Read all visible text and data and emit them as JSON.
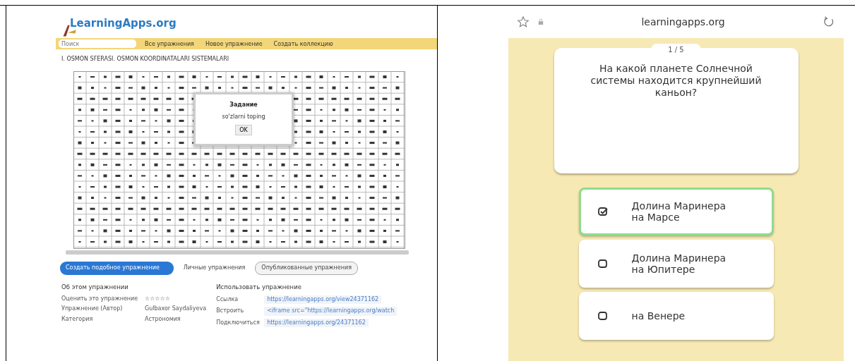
{
  "left_screen": {
    "logo": "LearningApps.org",
    "toolbar": {
      "search": {
        "placeholder": "Поиск"
      },
      "buttons": [
        "Все упражнения",
        "Новое упражнение",
        "Создать коллекцию"
      ]
    },
    "title": "I. OSMON SFERASI. OSMON KOORDINATALARI SISTEMALARI",
    "dialog": {
      "title": "Задание",
      "text": "so'zlarni toping",
      "button": "OK"
    },
    "actions": [
      {
        "label": "Создать подобное упражнение",
        "kind": "primary"
      },
      {
        "label": "Личные упражнения",
        "kind": "plain"
      },
      {
        "label": "Опубликованные упражнения",
        "kind": "outlined"
      }
    ],
    "about": {
      "heading": "Об этом упражнении",
      "rows": [
        {
          "label": "Оценить это упражнение",
          "value": "☆☆☆☆☆"
        },
        {
          "label": "Упражнение (Автор)",
          "value": "Gulbaxor Saydaliyeva"
        },
        {
          "label": "Категория",
          "value": "Астрономия"
        }
      ]
    },
    "use": {
      "heading": "Использовать упражнение",
      "rows": [
        {
          "label": "Ссылка",
          "value": "https://learningapps.org/view24371162"
        },
        {
          "label": "Встроить",
          "value": "<iframe src=\"https://learningapps.org/watch"
        },
        {
          "label": "Подключиться",
          "value": "https://learningapps.org/24371162"
        }
      ]
    }
  },
  "right_screen": {
    "url": "learningapps.org",
    "counter": "1 / 5",
    "question": "На какой планете Солнечной системы находится крупнейший каньон?",
    "answers": [
      {
        "text": "Долина Маринера на Марсе",
        "selected": true
      },
      {
        "text": "Долина Маринера на Юпитере",
        "selected": false
      },
      {
        "text": "на Венере",
        "selected": false
      }
    ]
  }
}
